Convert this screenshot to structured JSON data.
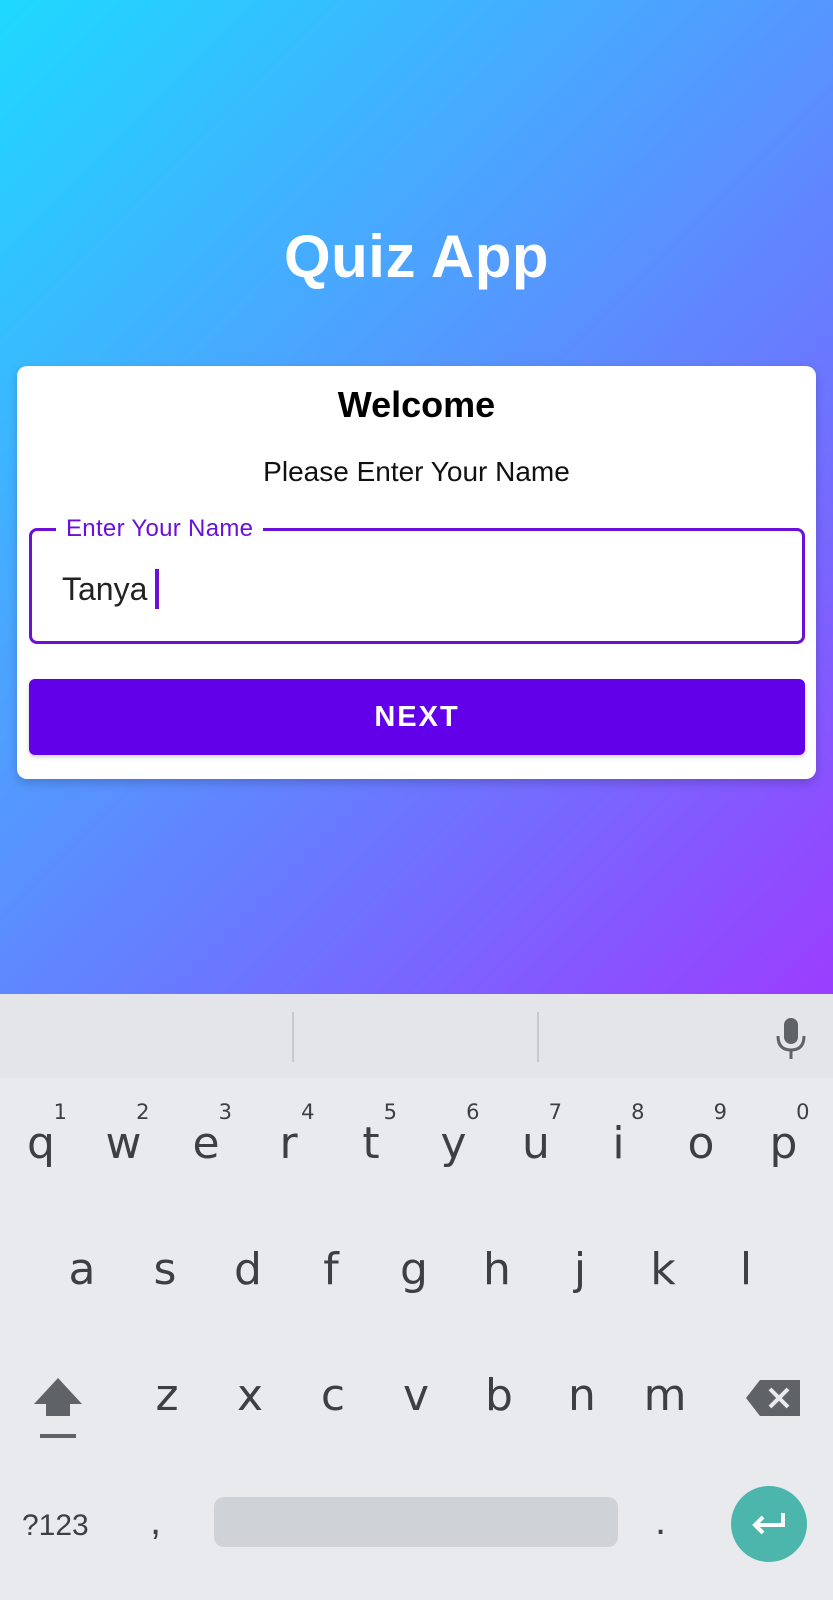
{
  "app": {
    "title": "Quiz App",
    "card": {
      "heading": "Welcome",
      "subtitle": "Please Enter Your Name",
      "name_field": {
        "label": "Enter Your Name",
        "value": "Tanya"
      },
      "next_label": "NEXT"
    }
  },
  "keyboard": {
    "row1": [
      {
        "key": "q",
        "num": "1"
      },
      {
        "key": "w",
        "num": "2"
      },
      {
        "key": "e",
        "num": "3"
      },
      {
        "key": "r",
        "num": "4"
      },
      {
        "key": "t",
        "num": "5"
      },
      {
        "key": "y",
        "num": "6"
      },
      {
        "key": "u",
        "num": "7"
      },
      {
        "key": "i",
        "num": "8"
      },
      {
        "key": "o",
        "num": "9"
      },
      {
        "key": "p",
        "num": "0"
      }
    ],
    "row2": [
      "a",
      "s",
      "d",
      "f",
      "g",
      "h",
      "j",
      "k",
      "l"
    ],
    "row3": [
      "z",
      "x",
      "c",
      "v",
      "b",
      "n",
      "m"
    ],
    "symbols_label": "?123",
    "comma": ",",
    "period": ".",
    "icons": [
      "mic-icon",
      "shift-icon",
      "backspace-icon",
      "enter-icon"
    ],
    "enter_color": "#4db6ac"
  },
  "colors": {
    "accent": "#6200ea",
    "field_border": "#6b10d8"
  }
}
